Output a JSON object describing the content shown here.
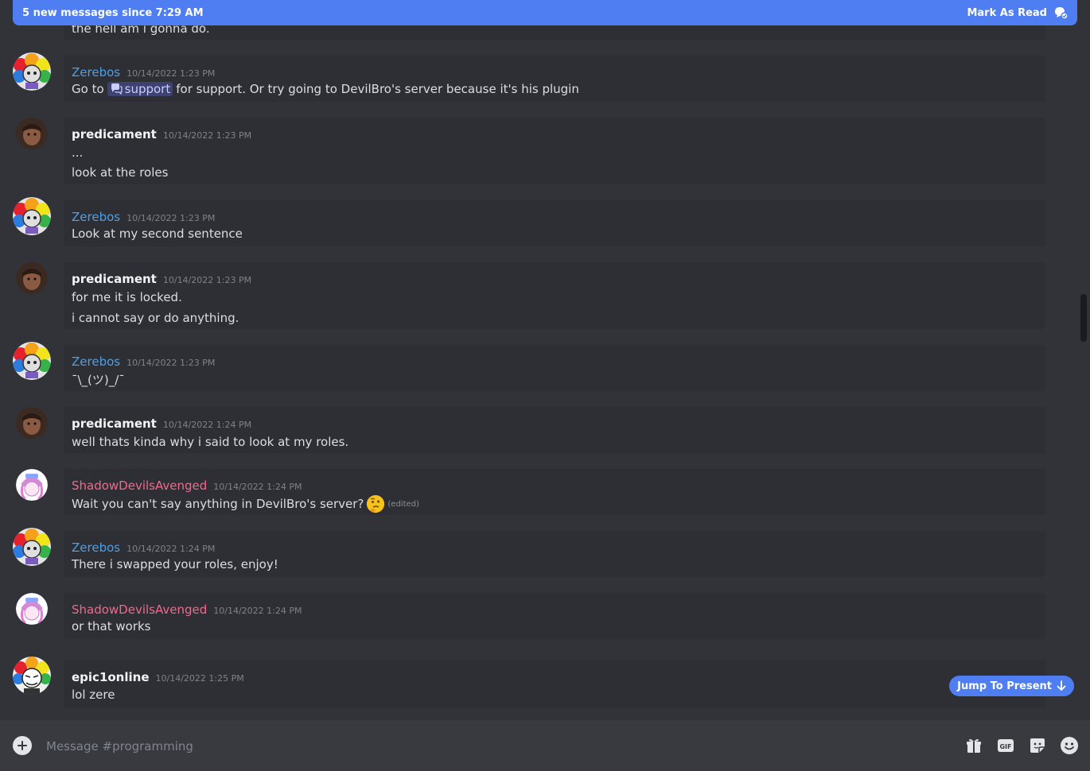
{
  "new_messages_bar": {
    "text": "5 new messages since 7:29 AM",
    "mark_read_label": "Mark As Read"
  },
  "truncated_text": "the hell am i gonna do.",
  "messages": [
    {
      "author": "Zerebos",
      "timestamp": "10/14/2022 1:23 PM",
      "lines": [
        "Go to",
        "support",
        "for support. Or try going to DevilBro's server because it's his plugin"
      ]
    },
    {
      "author": "predicament",
      "timestamp": "10/14/2022 1:23 PM",
      "lines": [
        "...",
        "look at the roles"
      ]
    },
    {
      "author": "Zerebos",
      "timestamp": "10/14/2022 1:23 PM",
      "lines": [
        "Look at my second sentence"
      ]
    },
    {
      "author": "predicament",
      "timestamp": "10/14/2022 1:23 PM",
      "lines": [
        "for me it is locked.",
        "i cannot say or do anything."
      ]
    },
    {
      "author": "Zerebos",
      "timestamp": "10/14/2022 1:23 PM",
      "lines": [
        "¯\\_(ツ)_/¯"
      ]
    },
    {
      "author": "predicament",
      "timestamp": "10/14/2022 1:24 PM",
      "lines": [
        "well thats kinda why i said to look at my roles."
      ]
    },
    {
      "author": "ShadowDevilsAvenged",
      "timestamp": "10/14/2022 1:24 PM",
      "lines": [
        "Wait you can't say anything in DevilBro's server?"
      ],
      "edited": "(edited)"
    },
    {
      "author": "Zerebos",
      "timestamp": "10/14/2022 1:24 PM",
      "lines": [
        "There i swapped your roles, enjoy!"
      ]
    },
    {
      "author": "ShadowDevilsAvenged",
      "timestamp": "10/14/2022 1:24 PM",
      "lines": [
        "or that works"
      ]
    },
    {
      "author": "epic1online",
      "timestamp": "10/14/2022 1:25 PM",
      "lines": [
        "lol zere"
      ]
    }
  ],
  "jump_to_present": "Jump To Present",
  "composer": {
    "placeholder": "Message #programming"
  },
  "colors": {
    "accent": "#4e7ef2",
    "zerebos": "#4f9fe6",
    "shadow": "#ee6a8e"
  }
}
